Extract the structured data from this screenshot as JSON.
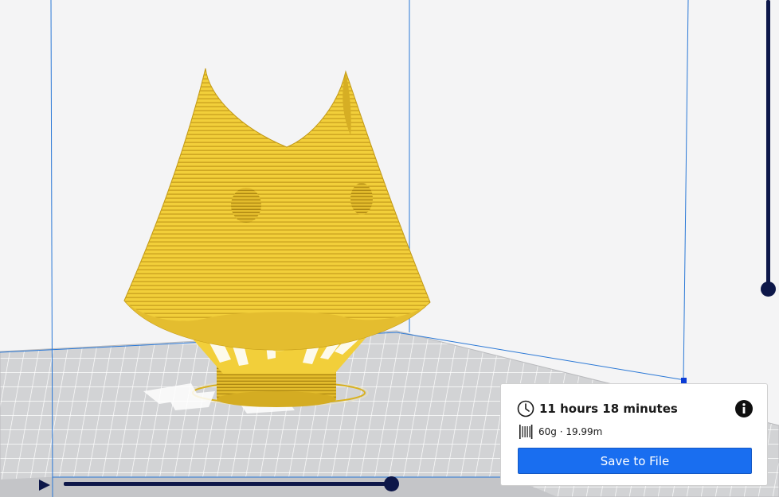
{
  "viewport": {
    "title": "3D preview of layered print",
    "colors": {
      "background": "#f4f4f5",
      "model_yellow": "#f2cf3a",
      "model_shadow": "#c9a21a",
      "build_volume_line": "#2a78d6",
      "buildplate": "#cfd0d2",
      "slider": "#0d1749"
    }
  },
  "layer_slider": {
    "level": 0.58
  },
  "simulation": {
    "play_icon": "play-icon",
    "progress": 0.97
  },
  "print_panel": {
    "time_icon": "clock-icon",
    "print_time": "11 hours 18 minutes",
    "info_icon": "info-icon",
    "material_icon": "spool-icon",
    "material": "60g · 19.99m",
    "save_label": "Save to File",
    "accent_color": "#196ef0"
  }
}
